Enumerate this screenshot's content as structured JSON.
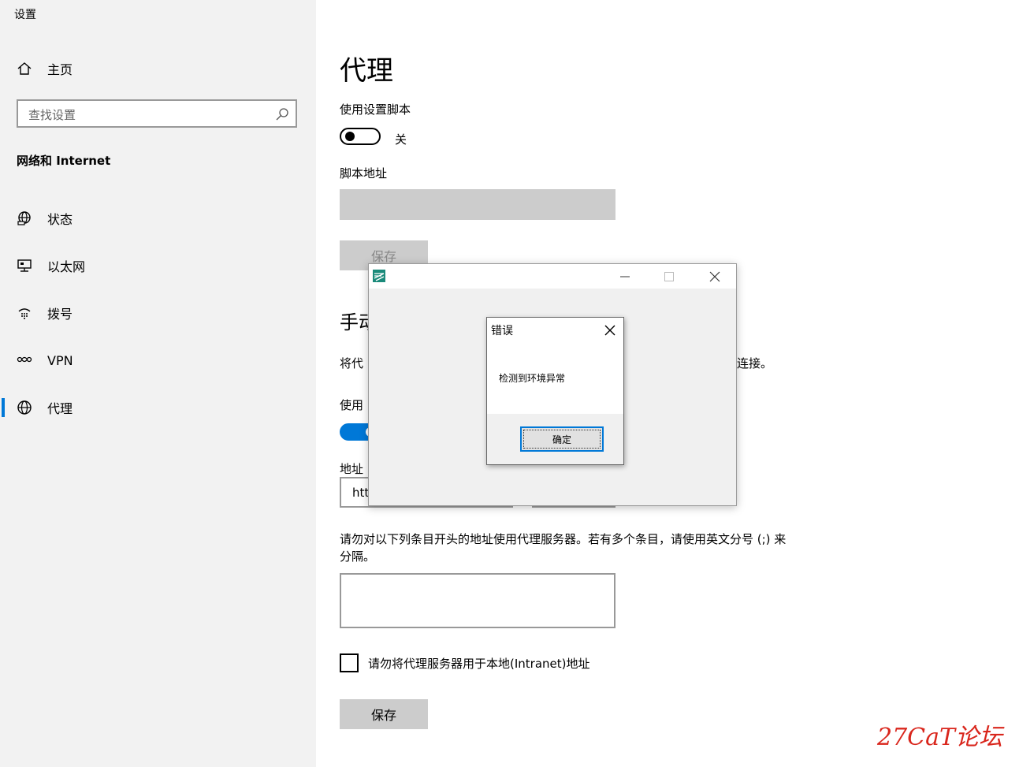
{
  "app": {
    "title": "设置"
  },
  "sidebar": {
    "home_label": "主页",
    "search_placeholder": "查找设置",
    "group_label": "网络和 Internet",
    "items": [
      {
        "label": "状态",
        "icon": "globe-status-icon"
      },
      {
        "label": "以太网",
        "icon": "ethernet-icon"
      },
      {
        "label": "拨号",
        "icon": "dialup-icon"
      },
      {
        "label": "VPN",
        "icon": "vpn-icon"
      },
      {
        "label": "代理",
        "icon": "globe-icon",
        "active": true
      }
    ],
    "accent": "#0078d7"
  },
  "main": {
    "title": "代理",
    "script": {
      "use_label": "使用设置脚本",
      "toggle_state": "关",
      "address_label": "脚本地址",
      "save_label": "保存"
    },
    "manual": {
      "heading_partial": "手动",
      "desc_start": "将代",
      "desc_end": "连接。",
      "use_label_partial": "使用",
      "address_label_partial": "地址",
      "address_value_partial": "htt",
      "exceptions_text": "请勿对以下列条目开头的地址使用代理服务器。若有多个条目，请使用英文分号 (;) 来分隔。",
      "local_checkbox_label": "请勿将代理服务器用于本地(Intranet)地址",
      "save_label": "保存"
    }
  },
  "app_window": {
    "minimize": "—",
    "maximize": "☐",
    "close": "✕"
  },
  "dialog": {
    "title": "错误",
    "message": "检测到环境异常",
    "ok_label": "确定"
  },
  "watermark": "27CaT论坛"
}
